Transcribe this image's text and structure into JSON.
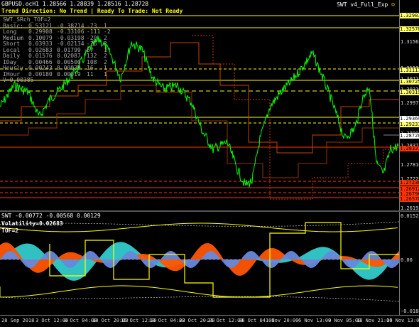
{
  "header": {
    "symbol_line": "GBPUSD.ocH1  1.28566 1.28839 1.28516 1.28728",
    "status_line": "Trend Direction:  No Trend  |  Ready To Trade:  Not Ready",
    "ea_name": "SWT v4_Full_Exp",
    "ea_icon": "smiley-icon",
    "table_title": "SWT_SRch_TOF=2"
  },
  "stats_table": [
    [
      "Basic:",
      "0.53121",
      "-0.38714",
      "-73",
      "1"
    ],
    [
      "Long",
      "0.29908",
      "-0.33106",
      "-111",
      "-2"
    ],
    [
      "Medium",
      "0.10079",
      "-0.03198",
      "-20",
      "2"
    ],
    [
      "Short",
      "0.03933",
      "-0.02134",
      "-26",
      "2"
    ],
    [
      "Local",
      "0.02683",
      "0.01799",
      "67",
      "1"
    ],
    [
      "Daily",
      "0.01576",
      "0.02087",
      "132",
      "2"
    ],
    [
      "IDay",
      "0.00466",
      "0.00500",
      "108",
      "2"
    ],
    [
      "Hourly",
      "0.00243",
      "0.00039",
      "16",
      "1"
    ],
    [
      "IHour",
      "0.00180",
      "0.00019",
      "11",
      "1"
    ]
  ],
  "vol_line": "V=0.00385",
  "price_scale": {
    "labels": [
      "1.32083",
      "1.31565",
      "1.31117",
      "1.30725",
      "1.30319",
      "1.29972",
      "1.29369",
      "1.28895",
      "1.28372",
      "1.27816",
      "1.27229",
      "1.26712"
    ],
    "tags": [
      {
        "text": "1.32983",
        "color": "#ffff66"
      },
      {
        "text": "1.32578",
        "color": "#ffff66"
      },
      {
        "text": "1.31117",
        "color": "#ffff66"
      },
      {
        "text": "1.30725",
        "color": "#ffff66"
      },
      {
        "text": "1.30319",
        "color": "#ffff66"
      },
      {
        "text": "1.29369",
        "color": "#ffffff"
      },
      {
        "text": "1.29231",
        "color": "#ffff66"
      },
      {
        "text": "1.28728",
        "color": "#ffffff"
      },
      {
        "text": "1.28337",
        "color": "#ff3300"
      },
      {
        "text": "1.27236",
        "color": "#ff3300"
      },
      {
        "text": "1.26912",
        "color": "#ff3300"
      },
      {
        "text": "1.26796",
        "color": "#ff3300"
      },
      {
        "text": "1.26570",
        "color": "#ff3300"
      }
    ],
    "bottom": "1.26195"
  },
  "indicator": {
    "title": "SWT -0.00772 -0.00568 0.00129",
    "volatility": "Volatility=0.02683",
    "tof": "TOF=2",
    "scale_top": "0.01522",
    "scale_mid": "0.00",
    "scale_bottom": "-0.0188"
  },
  "time_axis": [
    "28 Sep 2018",
    "3 Oct 12:00",
    "8 Oct 04:00",
    "10 Oct 20:00",
    "15 Oct 12:00",
    "18 Oct 04:00",
    "22 Oct 20:00",
    "25 Oct 12:00",
    "30 Oct 04:00",
    "1 Nov 20:00",
    "6 Nov 13:00",
    "9 Nov 05:00",
    "13 Nov 21:00",
    "16 Nov 13:00"
  ],
  "colors": {
    "price_line": "#00ff00",
    "level_yellow": "#ffff00",
    "level_red": "#ff3300",
    "hist_orange": "#ff5500",
    "hist_cyan": "#33cccc",
    "hist_blue": "#6688dd"
  }
}
